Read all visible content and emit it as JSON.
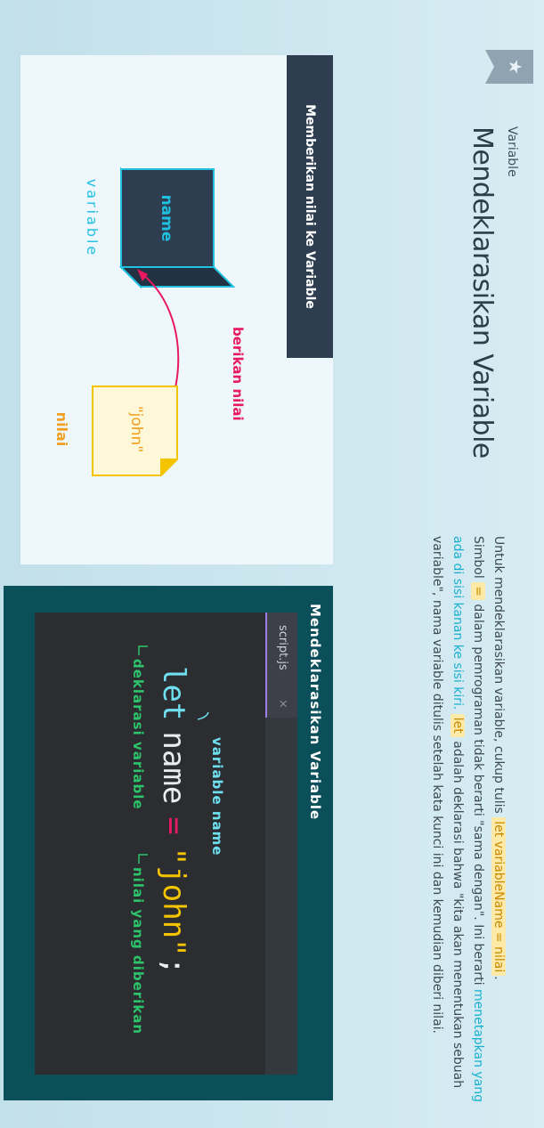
{
  "header": {
    "kicker": "Variable",
    "title": "Mendeklarasikan Variable"
  },
  "description": {
    "p1_a": "Untuk mendeklarasikan variable, cukup tulis ",
    "p1_code": "let variableName = nilai",
    "p1_b": ".",
    "p2_a": "Simbol ",
    "p2_code": "=",
    "p2_b": " dalam pemrograman tidak berarti \"sama dengan\". Ini berarti ",
    "p2_hl": "menetapkan yang ada di sisi kanan ke sisi kiri.",
    "p2_c": " ",
    "p2_code2": "let",
    "p2_d": " adalah deklarasi bahwa \"kita akan menentukan sebuah variable\", nama variable ditulis setelah kata kunci ini dan kemudian diberi nilai."
  },
  "left_card": {
    "header": "Memberikan nilai ke Variable",
    "box_label": "name",
    "box_caption": "variable",
    "arrow_label": "berikan nilai",
    "value_text": "\"john\"",
    "value_caption": "nilai"
  },
  "right_card": {
    "header": "Mendeklarasikan Variable",
    "tab_label": "script.js",
    "tab_close": "×",
    "code_let": "let",
    "code_name": "name",
    "code_eq": "=",
    "code_value": "\"john\"",
    "code_semi": ";",
    "ann_name": "variable name",
    "ann_decl": "deklarasi variable",
    "ann_value": "nilai yang diberikan"
  },
  "colors": {
    "accent_cyan": "#1bb0d0",
    "pink": "#e8195e",
    "orange": "#f0a020",
    "green": "#2dc36a",
    "navy": "#2e3d50",
    "teal": "#0b4f5b"
  }
}
